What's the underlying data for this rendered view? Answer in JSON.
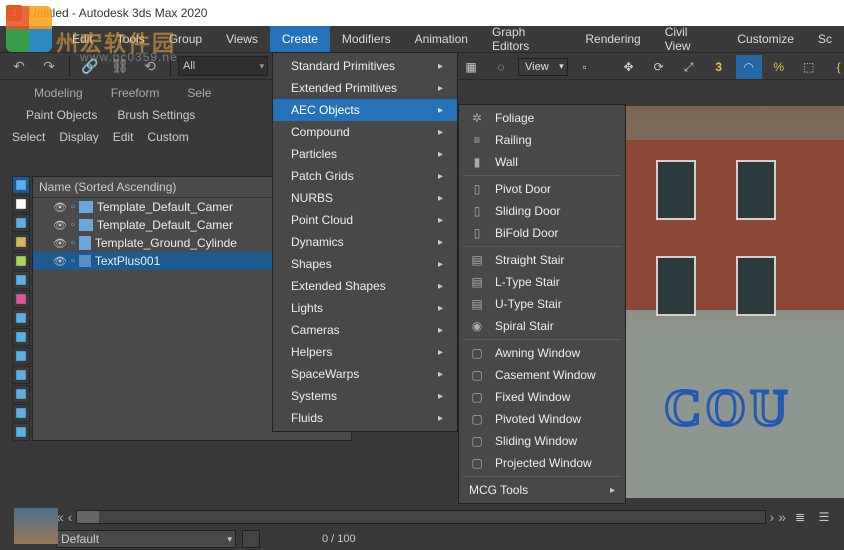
{
  "window": {
    "title": "Untitled - Autodesk 3ds Max 2020"
  },
  "menubar": [
    "Edit",
    "Tools",
    "Group",
    "Views",
    "Create",
    "Modifiers",
    "Animation",
    "Graph Editors",
    "Rendering",
    "Civil View",
    "Customize",
    "Sc"
  ],
  "menubar_open_index": 4,
  "toolbar": {
    "filter_dropdown": "All",
    "view_dropdown": "View"
  },
  "tabs": [
    "Modeling",
    "Freeform",
    "Sele"
  ],
  "subtabs": [
    "Paint Objects",
    "Brush Settings"
  ],
  "scene": {
    "menus": [
      "Select",
      "Display",
      "Edit",
      "Custom"
    ],
    "header": "Name (Sorted Ascending)",
    "rows": [
      {
        "name": "Template_Default_Camer",
        "type": "camera"
      },
      {
        "name": "Template_Default_Camer",
        "type": "camera"
      },
      {
        "name": "Template_Ground_Cylinde",
        "type": "cylinder"
      },
      {
        "name": "TextPlus001",
        "type": "text",
        "selected": true
      }
    ]
  },
  "create_menu": [
    "Standard Primitives",
    "Extended Primitives",
    "AEC Objects",
    "Compound",
    "Particles",
    "Patch Grids",
    "NURBS",
    "Point Cloud",
    "Dynamics",
    "Shapes",
    "Extended Shapes",
    "Lights",
    "Cameras",
    "Helpers",
    "SpaceWarps",
    "Systems",
    "Fluids"
  ],
  "create_menu_highlight_index": 2,
  "aec_menu": {
    "groups": [
      [
        "Foliage",
        "Railing",
        "Wall"
      ],
      [
        "Pivot Door",
        "Sliding Door",
        "BiFold Door"
      ],
      [
        "Straight Stair",
        "L-Type Stair",
        "U-Type Stair",
        "Spiral Stair"
      ],
      [
        "Awning Window",
        "Casement Window",
        "Fixed Window",
        "Pivoted Window",
        "Sliding Window",
        "Projected Window"
      ]
    ],
    "footer": "MCG Tools"
  },
  "bottom": {
    "layer_dropdown": "Default",
    "frame_readout": "0  /  100"
  },
  "viewport": {
    "text3d": "COU"
  },
  "watermark": {
    "big": "州宏软件园",
    "small": "www.pc0359.ne"
  }
}
